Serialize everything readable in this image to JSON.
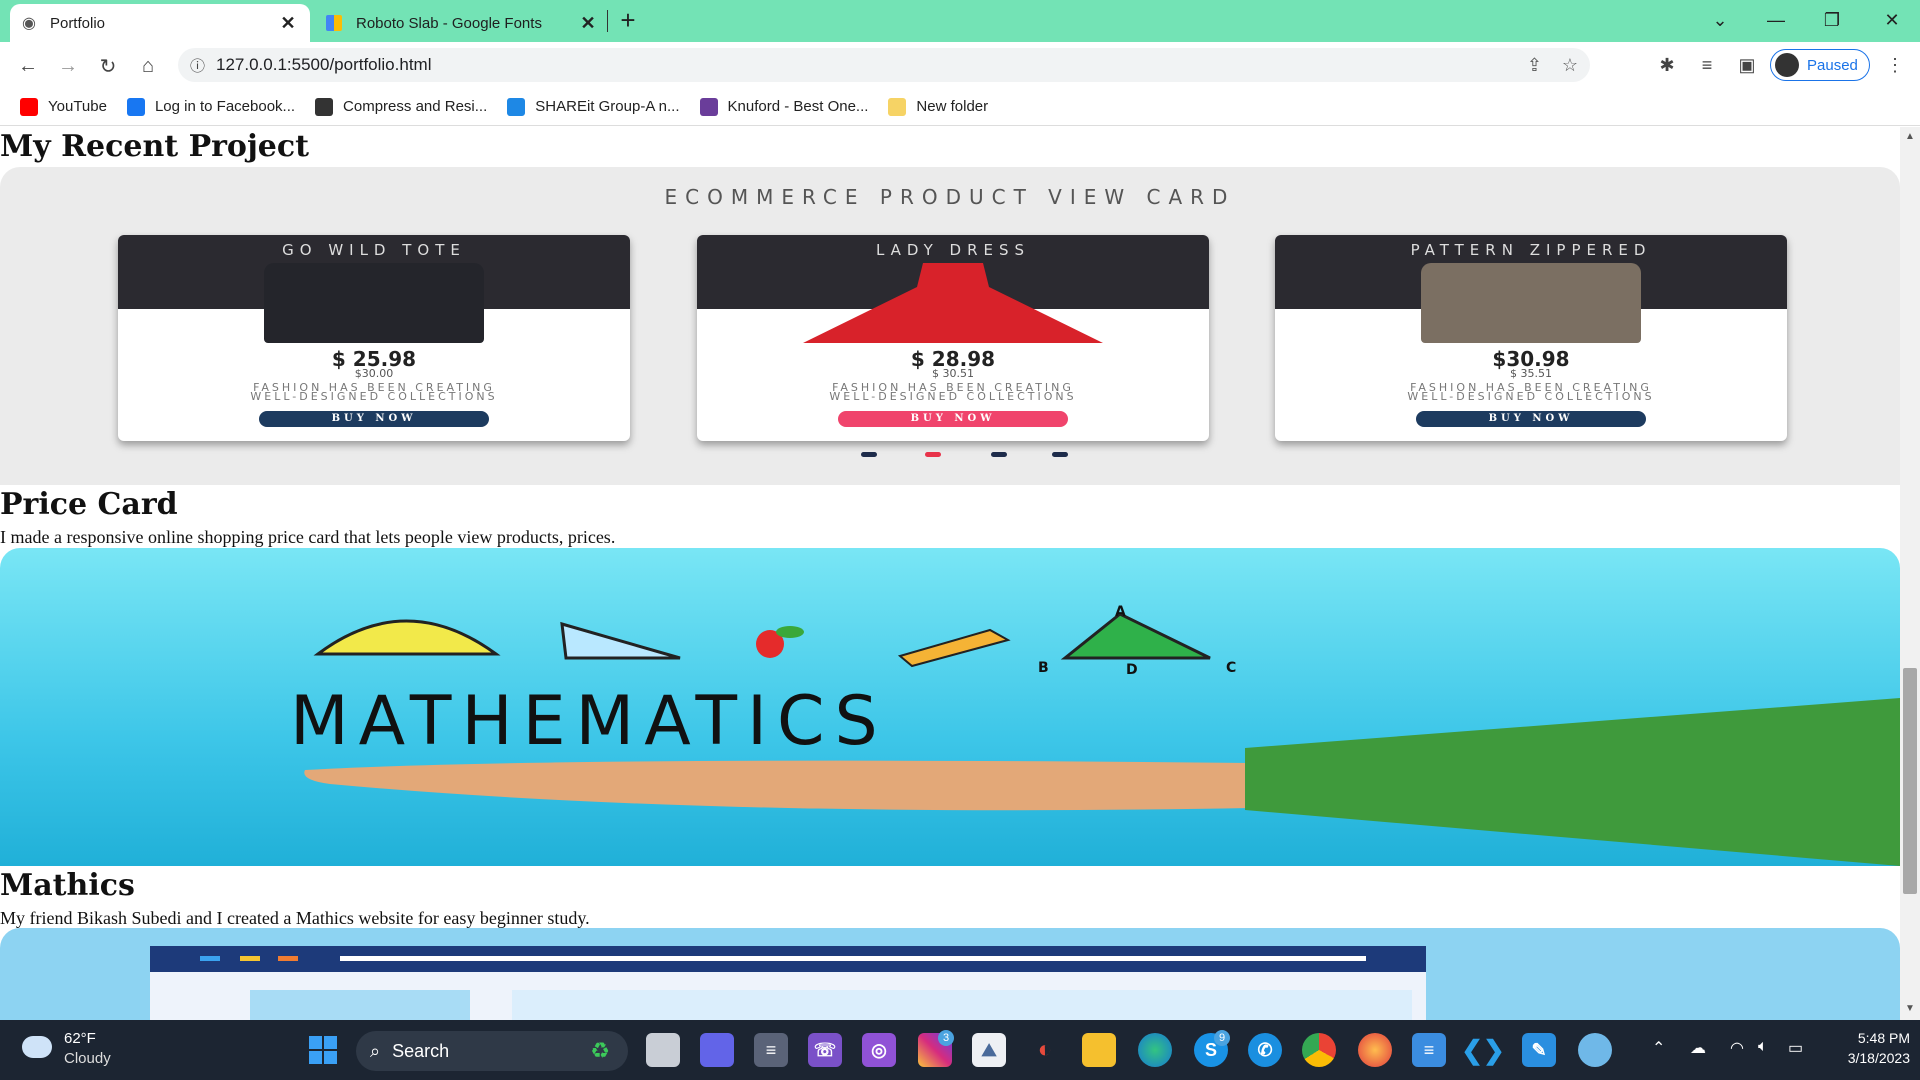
{
  "browser": {
    "tabs": [
      {
        "title": "Portfolio"
      },
      {
        "title": "Roboto Slab - Google Fonts"
      }
    ],
    "address": "127.0.0.1:5500/portfolio.html",
    "profile_label": "Paused",
    "bookmarks": [
      {
        "label": "YouTube",
        "color": "#ff0000",
        "icon": "youtube-icon"
      },
      {
        "label": "Log in to Facebook...",
        "color": "#1877f2",
        "icon": "facebook-icon"
      },
      {
        "label": "Compress and Resi...",
        "color": "#333333",
        "icon": "compress-icon"
      },
      {
        "label": "SHAREit Group-A n...",
        "color": "#1e88e5",
        "icon": "shareit-icon"
      },
      {
        "label": "Knuford - Best One...",
        "color": "#6a3d9a",
        "icon": "knuford-icon"
      },
      {
        "label": "New folder",
        "color": "#f6d365",
        "icon": "folder-icon"
      }
    ]
  },
  "page": {
    "recent_heading": "My Recent Project",
    "carousel": {
      "title": "ECOMMERCE PRODUCT VIEW CARD",
      "cards": [
        {
          "name": "GO WILD TOTE",
          "price": "$ 25.98",
          "old": "$30.00",
          "desc1": "FASHION HAS BEEN CREATING",
          "desc2": "WELL-DESIGNED COLLECTIONS",
          "buy": "BUY NOW",
          "btn": "#1d3b5f"
        },
        {
          "name": "LADY DRESS",
          "price": "$ 28.98",
          "old": "$ 30.51",
          "desc1": "FASHION HAS BEEN CREATING",
          "desc2": "WELL-DESIGNED COLLECTIONS",
          "buy": "BUY NOW",
          "btn": "#f0446c"
        },
        {
          "name": "PATTERN ZIPPERED",
          "price": "$30.98",
          "old": "$ 35.51",
          "desc1": "FASHION HAS BEEN CREATING",
          "desc2": "WELL-DESIGNED COLLECTIONS",
          "buy": "BUY NOW",
          "btn": "#1d3b5f"
        }
      ]
    },
    "price_card": {
      "heading": "Price Card",
      "desc": "I made a responsive online shopping price card that lets people view products, prices."
    },
    "math_banner_text": "MATHEMATICS",
    "math_banner_letters": {
      "b": "B",
      "d": "D",
      "c": "C",
      "a": "A"
    },
    "mathics": {
      "heading": "Mathics",
      "desc": "My friend Bikash Subedi and I created a Mathics website for easy beginner study."
    }
  },
  "taskbar": {
    "weather_temp": "62°F",
    "weather_cond": "Cloudy",
    "search_label": "Search",
    "time": "5:48 PM",
    "date": "3/18/2023",
    "badges": {
      "instagram": "3",
      "skype": "9"
    }
  }
}
